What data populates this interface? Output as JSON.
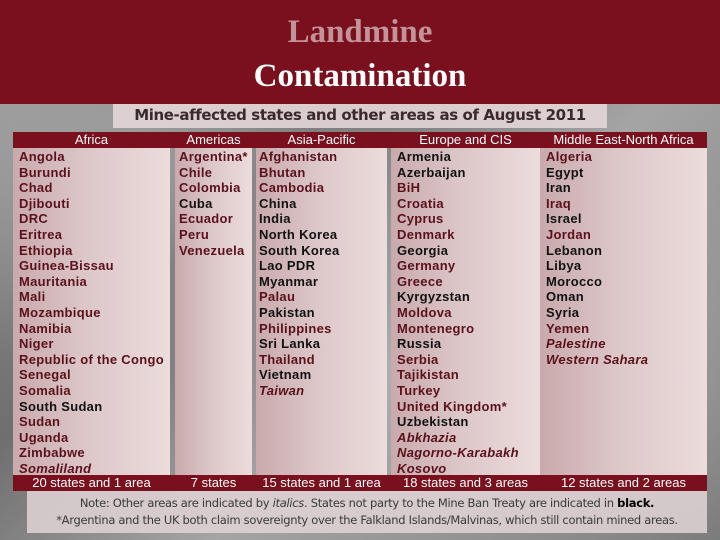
{
  "title": {
    "line1": "Landmine",
    "line2": "Contamination"
  },
  "subtitle": "Mine-affected states and other areas as of August 2011",
  "colors": {
    "brand_red": "#7a0f1e",
    "party_state_text": "#5a111b",
    "non_party_state_text": "#111111"
  },
  "regions": [
    {
      "name": "Africa",
      "summary": "20 states and 1 area",
      "items": [
        {
          "name": "Angola",
          "party": true,
          "area": false
        },
        {
          "name": "Burundi",
          "party": true,
          "area": false
        },
        {
          "name": "Chad",
          "party": true,
          "area": false
        },
        {
          "name": "Djibouti",
          "party": true,
          "area": false
        },
        {
          "name": "DRC",
          "party": true,
          "area": false
        },
        {
          "name": "Eritrea",
          "party": true,
          "area": false
        },
        {
          "name": "Ethiopia",
          "party": true,
          "area": false
        },
        {
          "name": "Guinea-Bissau",
          "party": true,
          "area": false
        },
        {
          "name": "Mauritania",
          "party": true,
          "area": false
        },
        {
          "name": "Mali",
          "party": true,
          "area": false
        },
        {
          "name": "Mozambique",
          "party": true,
          "area": false
        },
        {
          "name": "Namibia",
          "party": true,
          "area": false
        },
        {
          "name": "Niger",
          "party": true,
          "area": false
        },
        {
          "name": "Republic of the Congo",
          "party": true,
          "area": false
        },
        {
          "name": "Senegal",
          "party": true,
          "area": false
        },
        {
          "name": "Somalia",
          "party": true,
          "area": false
        },
        {
          "name": "South Sudan",
          "party": false,
          "area": false
        },
        {
          "name": "Sudan",
          "party": true,
          "area": false
        },
        {
          "name": "Uganda",
          "party": true,
          "area": false
        },
        {
          "name": "Zimbabwe",
          "party": true,
          "area": false
        },
        {
          "name": "Somaliland",
          "party": true,
          "area": true
        }
      ]
    },
    {
      "name": "Americas",
      "summary": "7 states",
      "items": [
        {
          "name": "Argentina*",
          "party": true,
          "area": false
        },
        {
          "name": "Chile",
          "party": true,
          "area": false
        },
        {
          "name": "Colombia",
          "party": true,
          "area": false
        },
        {
          "name": "Cuba",
          "party": false,
          "area": false
        },
        {
          "name": "Ecuador",
          "party": true,
          "area": false
        },
        {
          "name": "Peru",
          "party": true,
          "area": false
        },
        {
          "name": "Venezuela",
          "party": true,
          "area": false
        }
      ]
    },
    {
      "name": "Asia-Pacific",
      "summary": "15 states and 1 area",
      "items": [
        {
          "name": "Afghanistan",
          "party": true,
          "area": false
        },
        {
          "name": "Bhutan",
          "party": true,
          "area": false
        },
        {
          "name": "Cambodia",
          "party": true,
          "area": false
        },
        {
          "name": "China",
          "party": false,
          "area": false
        },
        {
          "name": "India",
          "party": false,
          "area": false
        },
        {
          "name": "North Korea",
          "party": false,
          "area": false
        },
        {
          "name": "South Korea",
          "party": false,
          "area": false
        },
        {
          "name": "Lao PDR",
          "party": false,
          "area": false
        },
        {
          "name": "Myanmar",
          "party": false,
          "area": false
        },
        {
          "name": "Palau",
          "party": true,
          "area": false
        },
        {
          "name": "Pakistan",
          "party": false,
          "area": false
        },
        {
          "name": "Philippines",
          "party": true,
          "area": false
        },
        {
          "name": "Sri Lanka",
          "party": false,
          "area": false
        },
        {
          "name": "Thailand",
          "party": true,
          "area": false
        },
        {
          "name": "Vietnam",
          "party": false,
          "area": false
        },
        {
          "name": "Taiwan",
          "party": true,
          "area": true
        }
      ]
    },
    {
      "name": "Europe and CIS",
      "summary": "18  states and 3 areas",
      "items": [
        {
          "name": "Armenia",
          "party": false,
          "area": false
        },
        {
          "name": "Azerbaijan",
          "party": false,
          "area": false
        },
        {
          "name": "BiH",
          "party": true,
          "area": false
        },
        {
          "name": "Croatia",
          "party": true,
          "area": false
        },
        {
          "name": "Cyprus",
          "party": true,
          "area": false
        },
        {
          "name": "Denmark",
          "party": true,
          "area": false
        },
        {
          "name": "Georgia",
          "party": false,
          "area": false
        },
        {
          "name": "Germany",
          "party": true,
          "area": false
        },
        {
          "name": "Greece",
          "party": true,
          "area": false
        },
        {
          "name": "Kyrgyzstan",
          "party": false,
          "area": false
        },
        {
          "name": "Moldova",
          "party": true,
          "area": false
        },
        {
          "name": "Montenegro",
          "party": true,
          "area": false
        },
        {
          "name": "Russia",
          "party": false,
          "area": false
        },
        {
          "name": "Serbia",
          "party": true,
          "area": false
        },
        {
          "name": "Tajikistan",
          "party": true,
          "area": false
        },
        {
          "name": "Turkey",
          "party": true,
          "area": false
        },
        {
          "name": "United Kingdom*",
          "party": true,
          "area": false
        },
        {
          "name": "Uzbekistan",
          "party": false,
          "area": false
        },
        {
          "name": "Abkhazia",
          "party": true,
          "area": true
        },
        {
          "name": "Nagorno-Karabakh",
          "party": true,
          "area": true
        },
        {
          "name": "Kosovo",
          "party": true,
          "area": true
        }
      ]
    },
    {
      "name": "Middle East-North Africa",
      "summary": "12 states and 2 areas",
      "items": [
        {
          "name": "Algeria",
          "party": true,
          "area": false
        },
        {
          "name": "Egypt",
          "party": false,
          "area": false
        },
        {
          "name": "Iran",
          "party": false,
          "area": false
        },
        {
          "name": "Iraq",
          "party": true,
          "area": false
        },
        {
          "name": "Israel",
          "party": false,
          "area": false
        },
        {
          "name": "Jordan",
          "party": true,
          "area": false
        },
        {
          "name": "Lebanon",
          "party": false,
          "area": false
        },
        {
          "name": "Libya",
          "party": false,
          "area": false
        },
        {
          "name": "Morocco",
          "party": false,
          "area": false
        },
        {
          "name": "Oman",
          "party": false,
          "area": false
        },
        {
          "name": "Syria",
          "party": false,
          "area": false
        },
        {
          "name": "Yemen",
          "party": true,
          "area": false
        },
        {
          "name": "Palestine",
          "party": true,
          "area": true
        },
        {
          "name": "Western Sahara",
          "party": true,
          "area": true
        }
      ]
    }
  ],
  "notes": {
    "line1_pre": "Note: Other areas are indicated by ",
    "line1_italic": "italics",
    "line1_mid": ". States not party to the Mine Ban Treaty are indicated in ",
    "line1_bold": "black.",
    "line2": "*Argentina and the UK both claim sovereignty over the Falkland Islands/Malvinas, which still contain mined areas."
  }
}
